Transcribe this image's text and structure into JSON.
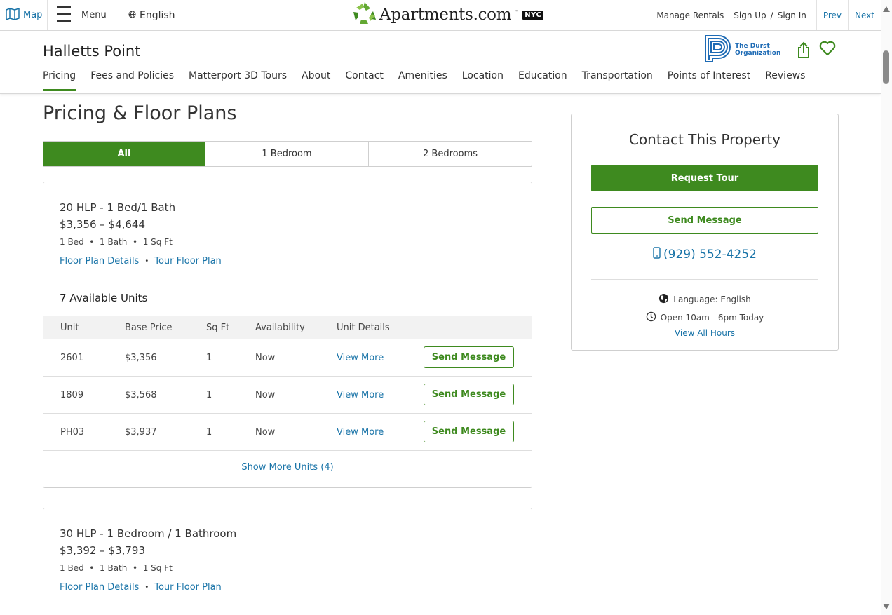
{
  "topbar": {
    "map_label": "Map",
    "menu_label": "Menu",
    "language_label": "English",
    "logo_text": "Apartments.com",
    "logo_tm": "™",
    "logo_region": "NYC",
    "manage_rentals": "Manage Rentals",
    "sign_up": "Sign Up",
    "separator": "/",
    "sign_in": "Sign In",
    "prev": "Prev",
    "next": "Next"
  },
  "property": {
    "name": "Halletts Point",
    "manager_logo_line1": "The Durst",
    "manager_logo_line2": "Organization",
    "nav": [
      "Pricing",
      "Fees and Policies",
      "Matterport 3D Tours",
      "About",
      "Contact",
      "Amenities",
      "Location",
      "Education",
      "Transportation",
      "Points of Interest",
      "Reviews"
    ]
  },
  "pricing": {
    "title": "Pricing & Floor Plans",
    "bed_tabs": [
      "All",
      "1 Bedroom",
      "2 Bedrooms"
    ],
    "plans": [
      {
        "name": "20 HLP - 1 Bed/1 Bath",
        "price": "$3,356 – $4,644",
        "details": "1 Bed  •  1 Bath  •  1 Sq Ft",
        "floor_plan_link": "Floor Plan Details",
        "tour_link": "Tour Floor Plan",
        "available": "7 Available Units",
        "columns": [
          "Unit",
          "Base Price",
          "Sq Ft",
          "Availability",
          "Unit Details"
        ],
        "units": [
          {
            "unit": "2601",
            "price": "$3,356",
            "sqft": "1",
            "availability": "Now",
            "details": "View More",
            "action": "Send Message"
          },
          {
            "unit": "1809",
            "price": "$3,568",
            "sqft": "1",
            "availability": "Now",
            "details": "View More",
            "action": "Send Message"
          },
          {
            "unit": "PH03",
            "price": "$3,937",
            "sqft": "1",
            "availability": "Now",
            "details": "View More",
            "action": "Send Message"
          }
        ],
        "show_more": "Show More Units (4)"
      },
      {
        "name": "30 HLP - 1 Bedroom / 1 Bathroom",
        "price": "$3,392 – $3,793",
        "details": "1 Bed  •  1 Bath  •  1 Sq Ft",
        "floor_plan_link": "Floor Plan Details",
        "tour_link": "Tour Floor Plan"
      }
    ]
  },
  "contact": {
    "title": "Contact This Property",
    "request_tour": "Request Tour",
    "send_message": "Send Message",
    "phone": "(929) 552-4252",
    "language": "Language: English",
    "hours": "Open 10am - 6pm Today",
    "view_all_hours": "View All Hours"
  },
  "colors": {
    "accent_green": "#3e8a1f",
    "link_blue": "#1a74a8"
  }
}
